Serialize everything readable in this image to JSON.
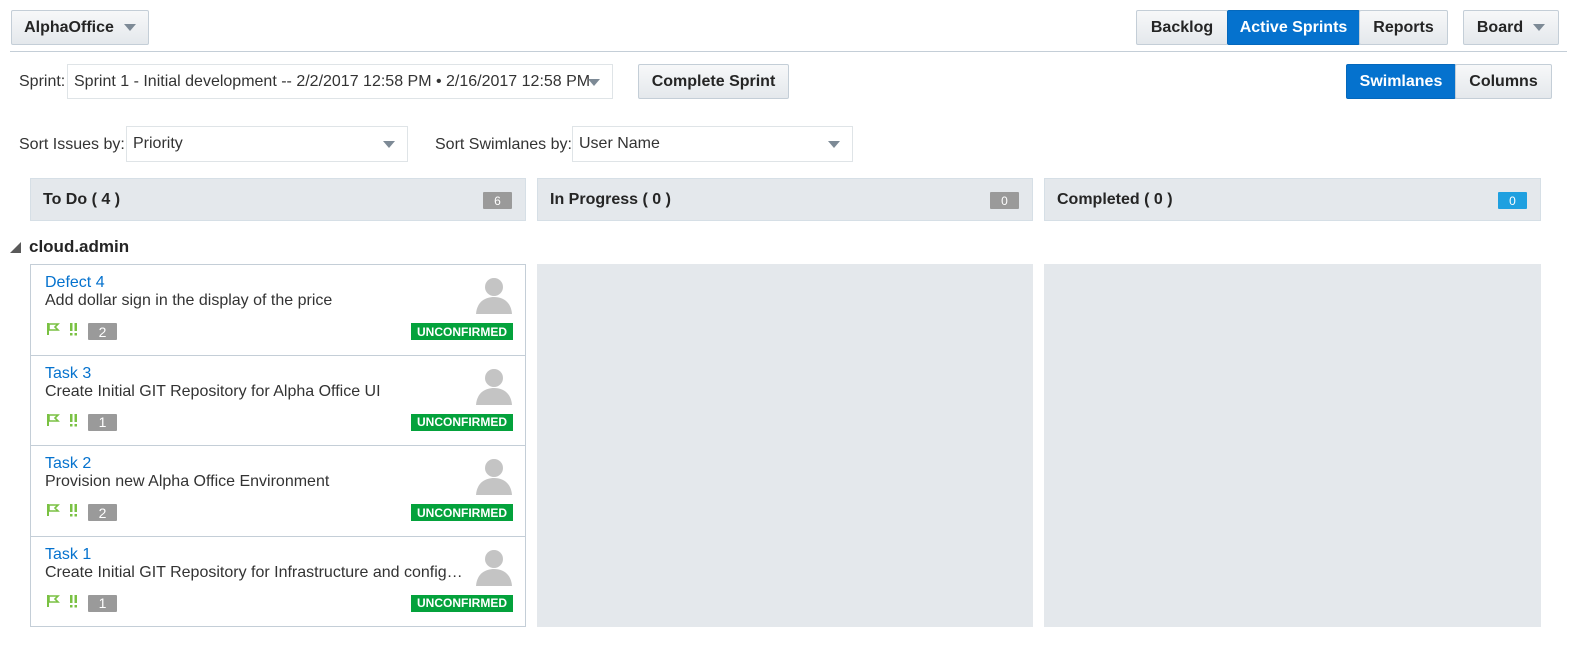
{
  "header": {
    "project_label": "AlphaOffice",
    "nav": {
      "backlog": "Backlog",
      "active_sprints": "Active Sprints",
      "reports": "Reports",
      "board": "Board"
    }
  },
  "sprint": {
    "label": "Sprint:",
    "value": "Sprint 1 - Initial development -- 2/2/2017 12:58 PM • 2/16/2017 12:58 PM",
    "complete_button": "Complete Sprint"
  },
  "view_toggle": {
    "swimlanes": "Swimlanes",
    "columns": "Columns",
    "active": "Swimlanes"
  },
  "sorting": {
    "issues_label": "Sort Issues by:",
    "issues_value": "Priority",
    "swimlanes_label": "Sort Swimlanes by:",
    "swimlanes_value": "User Name"
  },
  "columns": [
    {
      "title": "To Do ( 4 )",
      "count": "6",
      "count_color": "#9a9a9a"
    },
    {
      "title": "In Progress ( 0 )",
      "count": "0",
      "count_color": "#9a9a9a"
    },
    {
      "title": "Completed ( 0 )",
      "count": "0",
      "count_color": "#1fa0e0"
    }
  ],
  "swimlane": {
    "name": "cloud.admin",
    "cards": [
      {
        "id": "Defect 4",
        "title": "Add dollar sign in the display of the price",
        "points": "2",
        "status": "UNCONFIRMED"
      },
      {
        "id": "Task 3",
        "title": "Create Initial GIT Repository for Alpha Office UI",
        "points": "1",
        "status": "UNCONFIRMED"
      },
      {
        "id": "Task 2",
        "title": "Provision new Alpha Office Environment",
        "points": "2",
        "status": "UNCONFIRMED"
      },
      {
        "id": "Task 1",
        "title": "Create Initial GIT Repository for Infrastructure and configuration",
        "points": "1",
        "status": "UNCONFIRMED"
      }
    ]
  },
  "colors": {
    "accent": "#0572ce",
    "status_green": "#04a23c",
    "flag_green": "#7ac143",
    "column_bg": "#e4e8ec"
  }
}
